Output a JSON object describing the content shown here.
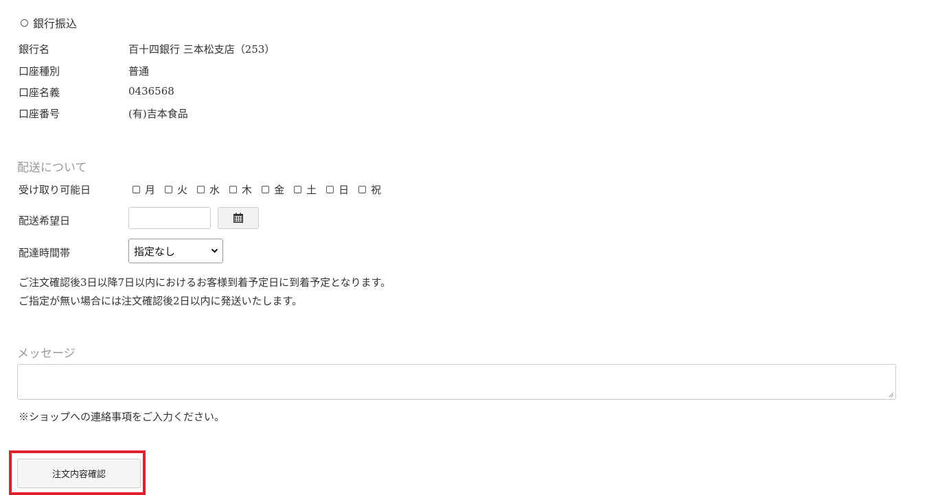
{
  "payment": {
    "option_label": "銀行振込",
    "rows": [
      {
        "key": "銀行名",
        "value": "百十四銀行 三本松支店（253）"
      },
      {
        "key": "口座種別",
        "value": "普通"
      },
      {
        "key": "口座名義",
        "value": "0436568"
      },
      {
        "key": "口座番号",
        "value": "(有)吉本食品"
      }
    ]
  },
  "delivery": {
    "heading": "配送について",
    "available_days_label": "受け取り可能日",
    "days": [
      "月",
      "火",
      "水",
      "木",
      "金",
      "土",
      "日",
      "祝"
    ],
    "desired_date_label": "配送希望日",
    "desired_date_value": "",
    "time_slot_label": "配達時間帯",
    "time_slot_selected": "指定なし",
    "notes": [
      "ご注文確認後3日以降7日以内におけるお客様到着予定日に到着予定となります。",
      "ご指定が無い場合には注文確認後2日以内に発送いたします。"
    ]
  },
  "message": {
    "heading": "メッセージ",
    "value": "",
    "note": "※ショップへの連絡事項をご入力ください。"
  },
  "actions": {
    "confirm_label": "注文内容確認"
  },
  "colors": {
    "highlight": "#e0202a",
    "heading_gray": "#999999"
  }
}
